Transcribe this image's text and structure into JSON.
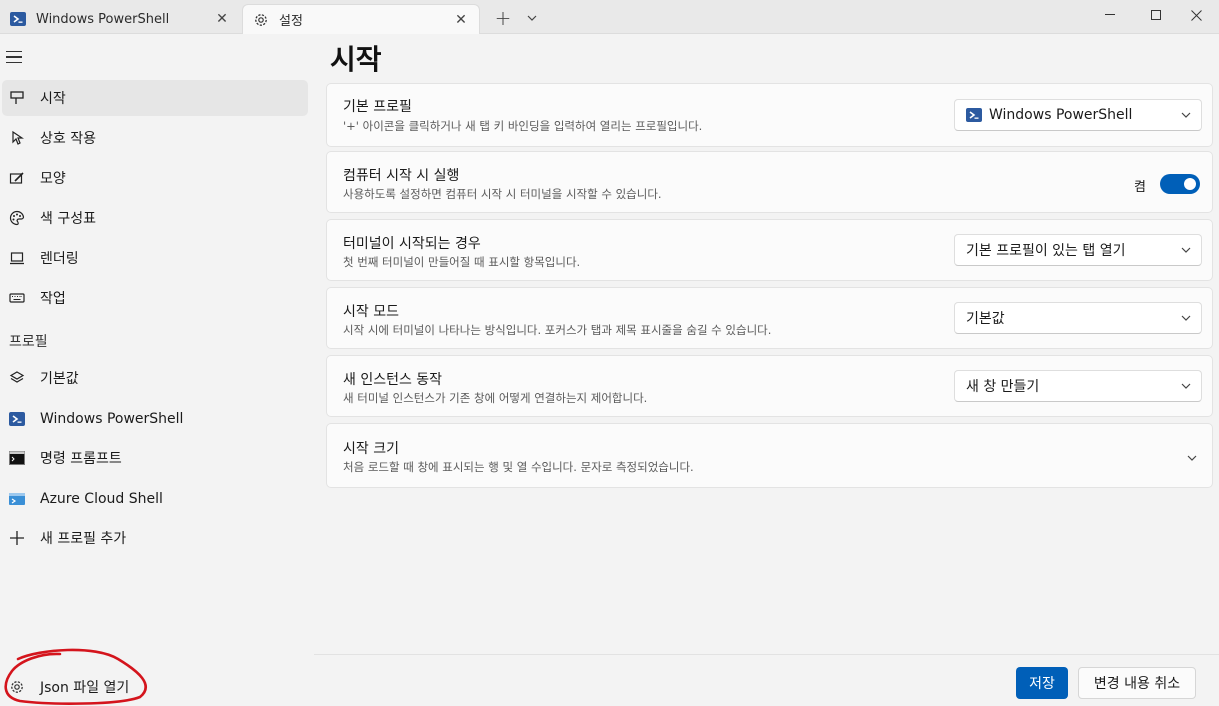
{
  "tabs": [
    {
      "title": "Windows PowerShell",
      "icon": "powershell-icon",
      "close": "✕"
    },
    {
      "title": "설정",
      "icon": "gear-icon",
      "close": "✕"
    }
  ],
  "tabbar": {
    "new_tab": "+",
    "menu": "chevron-down-icon"
  },
  "window_controls": [
    "minimize-icon",
    "maximize-icon",
    "close-icon"
  ],
  "sidebar": {
    "items": [
      {
        "label": "시작",
        "icon": "rocket-icon",
        "selected": true
      },
      {
        "label": "상호 작용",
        "icon": "pointer-icon"
      },
      {
        "label": "모양",
        "icon": "paint-icon"
      },
      {
        "label": "색 구성표",
        "icon": "palette-icon"
      },
      {
        "label": "렌더링",
        "icon": "monitor-icon"
      },
      {
        "label": "작업",
        "icon": "keyboard-icon"
      }
    ],
    "profiles_header": "프로필",
    "profiles": [
      {
        "label": "기본값",
        "icon": "layers-icon"
      },
      {
        "label": "Windows PowerShell",
        "icon": "powershell-icon"
      },
      {
        "label": "명령 프롬프트",
        "icon": "cmd-icon"
      },
      {
        "label": "Azure Cloud Shell",
        "icon": "azure-icon"
      },
      {
        "label": "새 프로필 추가",
        "icon": "plus-icon"
      }
    ],
    "json_link": "Json 파일 열기"
  },
  "main": {
    "title": "시작",
    "settings": [
      {
        "title": "기본 프로필",
        "desc": "'+' 아이콘을 클릭하거나 새 탭 키 바인딩을 입력하여 열리는 프로필입니다.",
        "control": "combo",
        "value": "Windows PowerShell"
      },
      {
        "title": "컴퓨터 시작 시 실행",
        "desc": "사용하도록 설정하면 컴퓨터 시작 시 터미널을 시작할 수 있습니다.",
        "control": "toggle",
        "value": "켬",
        "on": true
      },
      {
        "title": "터미널이 시작되는 경우",
        "desc": "첫 번째 터미널이 만들어질 때 표시할 항목입니다.",
        "control": "combo",
        "value": "기본 프로필이 있는 탭 열기"
      },
      {
        "title": "시작 모드",
        "desc": "시작 시에 터미널이 나타나는 방식입니다. 포커스가 탭과 제목 표시줄을 숨길 수 있습니다.",
        "control": "combo",
        "value": "기본값"
      },
      {
        "title": "새 인스턴스 동작",
        "desc": "새 터미널 인스턴스가 기존 창에 어떻게 연결하는지 제어합니다.",
        "control": "combo",
        "value": "새 창 만들기"
      },
      {
        "title": "시작 크기",
        "desc": "처음 로드할 때 창에 표시되는 행 및 열 수입니다. 문자로 측정되었습니다.",
        "control": "expander"
      }
    ]
  },
  "footer": {
    "save": "저장",
    "discard": "변경 내용 취소"
  },
  "colors": {
    "accent": "#005fb8",
    "annotation": "#d4141c",
    "powershell": "#2c5aa0"
  }
}
